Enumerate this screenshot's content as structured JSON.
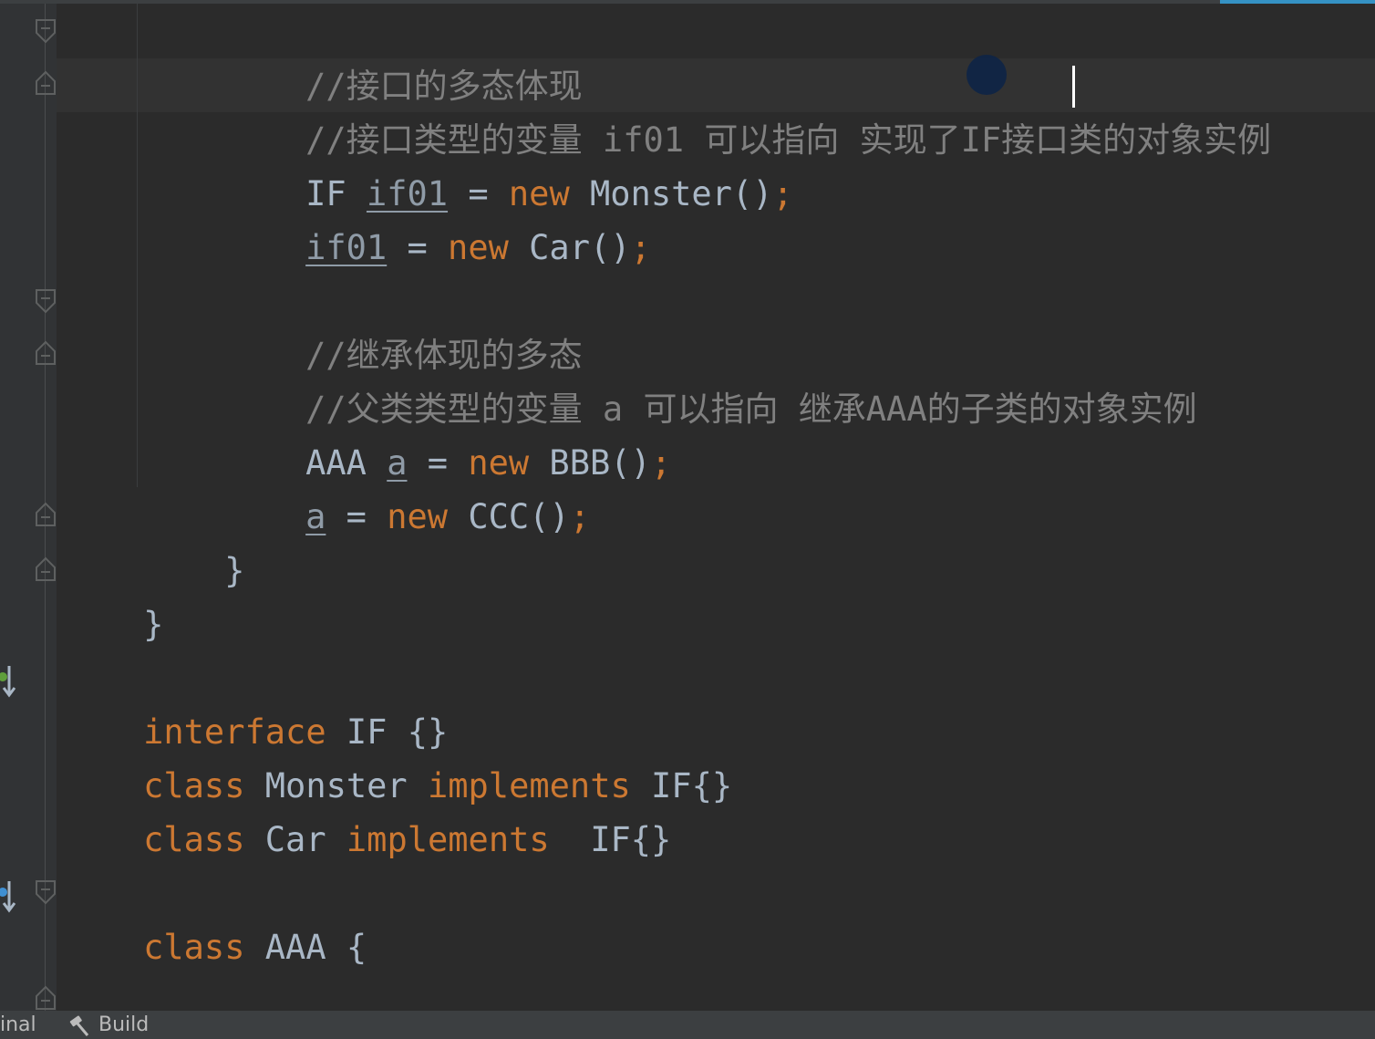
{
  "editor": {
    "lines": {
      "comment_interface_poly": "//接口的多态体现",
      "comment_interface_var": "//接口类型的变量 if01 可以指向 实现了IF接口类的对象实例",
      "l3_type": "IF",
      "l3_var": "if01",
      "l3_eq": " = ",
      "l3_new": "new",
      "l3_ctor": " Monster()",
      "semi": ";",
      "l4_var": "if01",
      "l4_eq": " = ",
      "l4_new": "new",
      "l4_ctor": " Car()",
      "comment_inherit_poly": "//继承体现的多态",
      "comment_inherit_var": "//父类类型的变量 a 可以指向 继承AAA的子类的对象实例",
      "l7_type": "AAA",
      "l7_var": "a",
      "l7_eq": " = ",
      "l7_new": "new",
      "l7_ctor": " BBB()",
      "l8_var": "a",
      "l8_eq": " = ",
      "l8_new": "new",
      "l8_ctor": " CCC()",
      "close_brace": "}",
      "kw_interface": "interface",
      "l11_rest": " IF {}",
      "kw_class": "class",
      "l12_name": " Monster ",
      "kw_implements": "implements",
      "l12_rest": " IF{}",
      "l13_name": " Car ",
      "l13_rest": "  IF{}",
      "l15_name": " AAA {"
    }
  },
  "statusbar": {
    "terminal_label": "inal",
    "build_label": "Build"
  },
  "colors": {
    "background": "#2b2b2b",
    "comment": "#808080",
    "keyword": "#cc7832",
    "identifier": "#a9b7c6",
    "accent": "#3592c4"
  }
}
